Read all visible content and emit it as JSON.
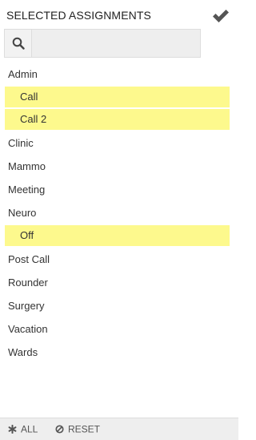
{
  "header": {
    "title": "SELECTED ASSIGNMENTS",
    "confirm_icon": "checkmark-icon"
  },
  "search": {
    "icon": "search-icon",
    "value": "",
    "placeholder": ""
  },
  "assignments": [
    {
      "label": "Admin",
      "selected": false
    },
    {
      "label": "Call",
      "selected": true
    },
    {
      "label": "Call 2",
      "selected": true
    },
    {
      "label": "Clinic",
      "selected": false
    },
    {
      "label": "Mammo",
      "selected": false
    },
    {
      "label": "Meeting",
      "selected": false
    },
    {
      "label": "Neuro",
      "selected": false
    },
    {
      "label": "Off",
      "selected": true
    },
    {
      "label": "Post Call",
      "selected": false
    },
    {
      "label": "Rounder",
      "selected": false
    },
    {
      "label": "Surgery",
      "selected": false
    },
    {
      "label": "Vacation",
      "selected": false
    },
    {
      "label": "Wards",
      "selected": false
    }
  ],
  "footer": {
    "all_label": "ALL",
    "all_icon": "asterisk-icon",
    "reset_label": "RESET",
    "reset_icon": "ban-icon"
  },
  "colors": {
    "selected_highlight": "#fdf98d",
    "footer_background": "#eeeeee"
  }
}
